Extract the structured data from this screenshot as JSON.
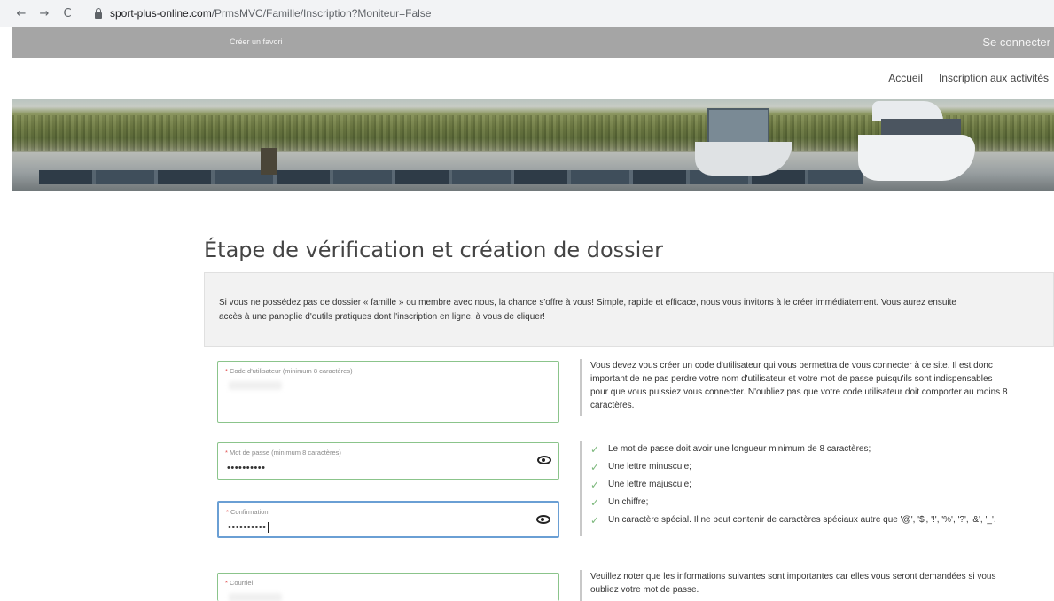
{
  "browser": {
    "back": "←",
    "forward": "→",
    "reload": "C",
    "url_domain": "sport-plus-online.com",
    "url_path": "/PrmsMVC/Famille/Inscription?Moniteur=False"
  },
  "top_bar": {
    "favorite": "Créer un favori",
    "login": "Se connecter",
    "bg_color": "#a5a5a5"
  },
  "nav": {
    "items": [
      "Accueil",
      "Inscription aux activités"
    ]
  },
  "page": {
    "title": "Étape de vérification et création de dossier",
    "intro_line1": "Si vous ne possédez pas de dossier « famille » ou membre avec nous, la chance s'offre à vous! Simple, rapide et efficace, nous vous invitons à le créer immédiatement. Vous aurez ensuite",
    "intro_line2": "accès à une panoplie d'outils pratiques dont l'inscription en ligne. à vous de cliquer!"
  },
  "form": {
    "required_mark": "*",
    "username": {
      "label": "Code d'utilisateur (minimum 8 caractères)",
      "value": ""
    },
    "password": {
      "label": "Mot de passe (minimum 8 caractères)",
      "value": "••••••••••"
    },
    "confirm": {
      "label": "Confirmation",
      "value": "••••••••••"
    },
    "email": {
      "label": "Courriel",
      "value": ""
    }
  },
  "help": {
    "username_lines": [
      "Vous devez vous créer un code d'utilisateur qui vous permettra de vous connecter à ce site. Il est donc",
      "important de ne pas perdre votre nom d'utilisateur et votre mot de passe puisqu'ils sont indispensables",
      "pour que vous puissiez vous connecter. N'oubliez pas que votre code utilisateur doit comporter au moins 8",
      "caractères."
    ],
    "password_rules": [
      "Le mot de passe doit avoir une longueur minimum de 8 caractères;",
      "Une lettre minuscule;",
      "Une lettre majuscule;",
      "Un chiffre;",
      "Un caractère spécial. Il ne peut contenir de caractères spéciaux autre que '@', '$', '!', '%', '?', '&', '_'."
    ],
    "check_icon": "✓",
    "email_lines": [
      "Veuillez noter que les informations suivantes sont importantes car elles vous seront demandées si vous",
      "oubliez votre mot de passe."
    ]
  },
  "colors": {
    "valid_border": "#8bc48b",
    "focus_border": "#6a9fd4",
    "check": "#7cb87c",
    "required": "#e05050"
  }
}
